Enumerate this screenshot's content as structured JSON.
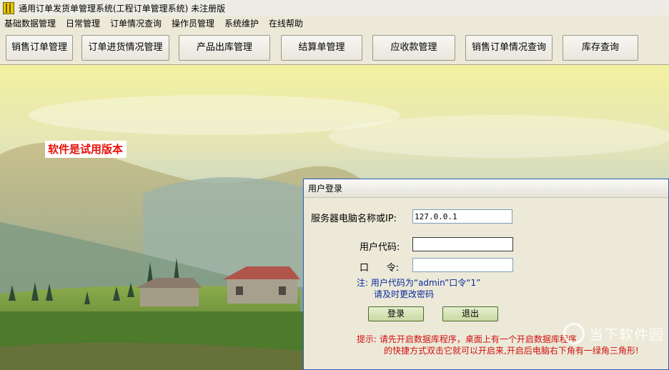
{
  "window": {
    "title": "通用订单发货单管理系统(工程订单管理系统) 未注册版",
    "icon": "app-icon"
  },
  "menu": {
    "items": [
      "基础数据管理",
      "日常管理",
      "订单情况查询",
      "操作员管理",
      "系统维护",
      "在线帮助"
    ]
  },
  "toolbar": {
    "buttons": [
      "销售订单管理",
      "订单进货情况管理",
      "产品出库管理",
      "结算单管理",
      "应收款管理",
      "销售订单情况查询",
      "库存查询"
    ]
  },
  "banner": {
    "trial_text": "软件是试用版本"
  },
  "login": {
    "title": "用户登录",
    "server_label": "服务器电脑名称或IP:",
    "server_value": "127.0.0.1",
    "user_label": "用户代码:",
    "user_value": "",
    "password_label": "口      令:",
    "password_value": "",
    "note_line1": "注: 用户代码为“admin”口令“1”",
    "note_line2": "请及时更改密码",
    "login_button": "登录",
    "exit_button": "退出",
    "hint_line1": "提示: 请先开启数据库程序，桌面上有一个开启数据库程序",
    "hint_line2": "的快捷方式双击它就可以开启来,开启后电脑右下角有一绿角三角形!"
  },
  "watermark": {
    "text": "当下软件园",
    "icon": "watermark-logo-icon"
  }
}
